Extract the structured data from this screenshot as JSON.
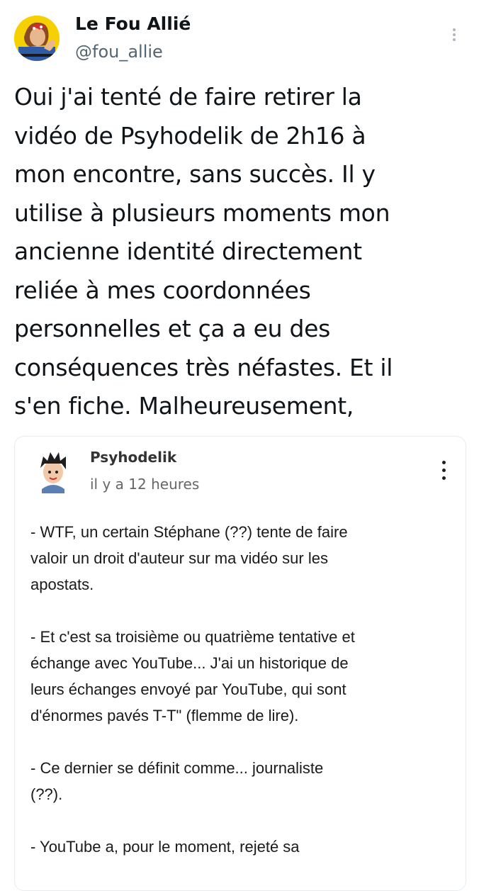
{
  "tweet": {
    "author_name": "Le Fou Allié",
    "author_handle": "@fou_allie",
    "menu_icon": "more-vertical-icon",
    "text_lines": [
      "Oui j'ai tenté de faire retirer la",
      "vidéo de Psyhodelik de 2h16 à",
      "mon encontre, sans succès. Il y",
      "utilise à plusieurs moments mon",
      "ancienne identité directement",
      "reliée à mes coordonnées",
      "personnelles et ça a eu des",
      "conséquences très néfastes. Et il",
      "s'en fiche. Malheureusement,"
    ]
  },
  "embed": {
    "author_name": "Psyhodelik",
    "timestamp": "il y a 12 heures",
    "menu_icon": "more-vertical-icon",
    "lines": [
      "- WTF, un certain Stéphane (??) tente de faire",
      "valoir un droit d'auteur sur ma vidéo sur les",
      "apostats.",
      "",
      "- Et c'est sa troisième ou quatrième tentative et",
      "échange avec YouTube... J'ai un historique de",
      "leurs échanges envoyé par YouTube, qui sont",
      "d'énormes pavés T-T\" (flemme de lire).",
      "",
      "- Ce dernier se définit comme... journaliste",
      "(??).",
      "",
      "- YouTube a, pour le moment, rejeté sa"
    ]
  },
  "colors": {
    "text_primary": "#0f1419",
    "text_secondary": "#536471",
    "avatar_background": "#f6d000",
    "embed_border": "#e8ecef"
  }
}
